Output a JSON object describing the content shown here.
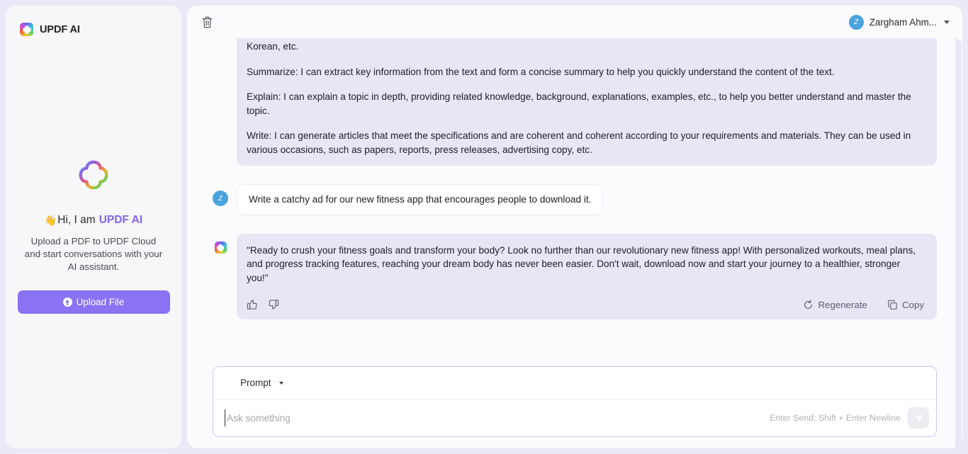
{
  "app": {
    "brand": "UPDF AI",
    "logo_icon": "updf-flower-logo",
    "page_bg": "#e9e9f8",
    "accent": "#8a72f2"
  },
  "sidebar": {
    "hero": {
      "logo_icon": "updf-flower-outline-logo",
      "sparkle_icons": [
        "sparkle-large-yellow",
        "sparkle-small-orange",
        "sparkle-large-purple",
        "sparkle-small-lilac"
      ],
      "wave_emoji": "👋",
      "greeting_prefix": "Hi, I am",
      "greeting_accent": "UPDF AI",
      "description": "Upload a PDF to UPDF Cloud and start conversations with your AI assistant."
    },
    "upload_button": {
      "label": "Upload File",
      "icon": "upload-circle-arrow-icon",
      "color": "#8a72f2"
    }
  },
  "topbar": {
    "delete_icon": "trash-icon",
    "user": {
      "avatar_initial": "Z",
      "avatar_color": "#4aa3dd",
      "name": "Zargham Ahm...",
      "caret_icon": "chevron-down-icon"
    }
  },
  "chat": {
    "messages": [
      {
        "role": "assistant",
        "avatar_icon": "updf-flower-logo",
        "clipped": true,
        "paragraphs": [
          "Korean, etc.",
          "Summarize: I can extract key information from the text and form a concise summary to help you quickly understand the content of the text.",
          "Explain: I can explain a topic in depth, providing related knowledge, background, explanations, examples, etc., to help you better understand and master the topic.",
          "Write: I can generate articles that meet the specifications and are coherent and coherent according to your requirements and materials. They can be used in various occasions, such as papers, reports, press releases, advertising copy, etc."
        ]
      },
      {
        "role": "user",
        "avatar_initial": "Z",
        "text": "Write a catchy ad for our new fitness app that encourages people to download it."
      },
      {
        "role": "assistant",
        "avatar_icon": "updf-flower-logo",
        "text": "\"Ready to crush your fitness goals and transform your body? Look no further than our revolutionary new fitness app! With personalized workouts, meal plans, and progress tracking features, reaching your dream body has never been easier. Don't wait, download now and start your journey to a healthier, stronger you!\"",
        "actions": {
          "thumbs_up_icon": "thumbs-up-icon",
          "thumbs_down_icon": "thumbs-down-icon",
          "regenerate_label": "Regenerate",
          "regenerate_icon": "refresh-icon",
          "copy_label": "Copy",
          "copy_icon": "copy-icon"
        }
      }
    ]
  },
  "composer": {
    "mode_label": "Prompt",
    "mode_icon": "sparkle-icon",
    "mode_caret_icon": "chevron-down-icon",
    "input_value": "",
    "input_placeholder": "Ask something",
    "hint": "Enter Send; Shift + Enter Newline",
    "send_icon": "send-plane-icon"
  }
}
